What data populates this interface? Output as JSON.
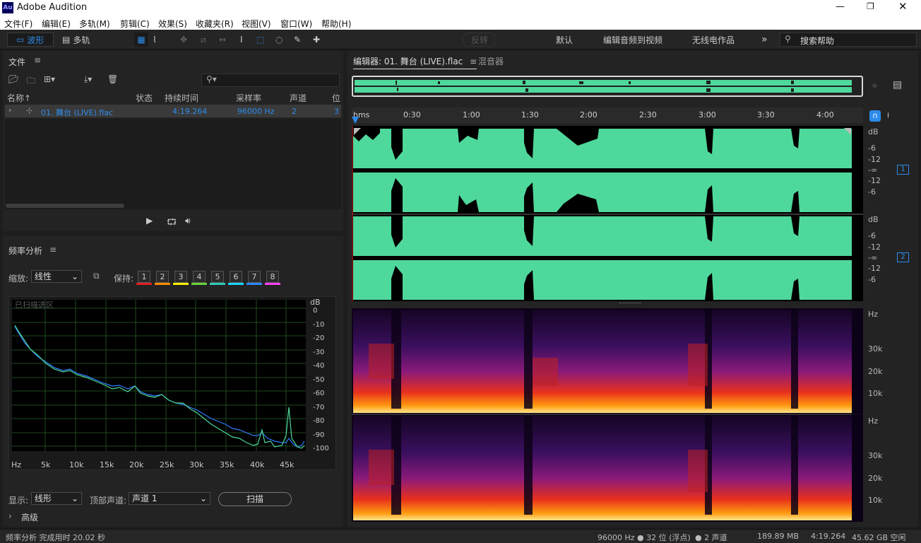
{
  "app": {
    "title": "Adobe Audition",
    "logo": "Au"
  },
  "menu": [
    "文件(F)",
    "编辑(E)",
    "多轨(M)",
    "剪辑(C)",
    "效果(S)",
    "收藏夹(R)",
    "视图(V)",
    "窗口(W)",
    "帮助(H)"
  ],
  "toolbar": {
    "waveform_label": "波形",
    "multitrack_label": "多轨",
    "reverse_label": "反转",
    "workspaces": [
      "默认",
      "编辑音频到视频",
      "无线电作品"
    ],
    "more": "»",
    "search_placeholder": "搜索帮助"
  },
  "files_panel": {
    "title": "文件",
    "columns": [
      "名称↑",
      "状态",
      "持续时间",
      "采样率",
      "声道",
      "位"
    ],
    "rows": [
      {
        "name": "01. 舞台 (LIVE).flac",
        "status": "",
        "duration": "4:19.264",
        "rate": "96000 Hz",
        "channels": "2",
        "bits": "3"
      }
    ]
  },
  "freq_panel": {
    "title": "频率分析",
    "zoom_label": "缩放:",
    "zoom_value": "线性",
    "hold_label": "保持:",
    "hold_buttons": [
      "1",
      "2",
      "3",
      "4",
      "5",
      "6",
      "7",
      "8"
    ],
    "hold_colors": [
      "#e02020",
      "#ff8a00",
      "#ffee00",
      "#66d43a",
      "#2fc9b8",
      "#1ad4ff",
      "#2a87ff",
      "#ff3df5"
    ],
    "scanned_label": "已扫描选区",
    "db_unit": "dB",
    "db_ticks": [
      "0",
      "-10",
      "-20",
      "-30",
      "-40",
      "-50",
      "-60",
      "-70",
      "-80",
      "-90",
      "-100"
    ],
    "x_ticks": [
      "Hz",
      "5k",
      "10k",
      "15k",
      "20k",
      "25k",
      "30k",
      "35k",
      "40k",
      "45k"
    ],
    "display_label": "显示:",
    "display_value": "线形",
    "top_channel_label": "顶部声道:",
    "top_channel_value": "声道 1",
    "scan_button": "扫描",
    "advanced_label": "高级"
  },
  "editor": {
    "tab_editor": "编辑器: 01. 舞台 (LIVE).flac",
    "tab_mixer": "混音器",
    "ruler": [
      "hms",
      "0:30",
      "1:00",
      "1:30",
      "2:00",
      "2:30",
      "3:00",
      "3:30",
      "4:00"
    ],
    "db_unit": "dB",
    "db_ticks": [
      "-6",
      "-12",
      "-∞",
      "-12",
      "-6"
    ],
    "channel_badges": [
      "1",
      "2"
    ],
    "hz_unit": "Hz",
    "hz_ticks": [
      "30k",
      "20k",
      "10k"
    ]
  },
  "status": {
    "left": "频率分析 完成用时 20.02 秒",
    "format": "96000 Hz ● 32 位 (浮点)",
    "channels": "● 2 声道",
    "size": "189.89 MB",
    "duration": "4:19.264",
    "free": "45.62 GB 空闲"
  },
  "colors": {
    "accent": "#2d8ceb",
    "waveform": "#4fd89b",
    "background": "#1d1d1d"
  }
}
